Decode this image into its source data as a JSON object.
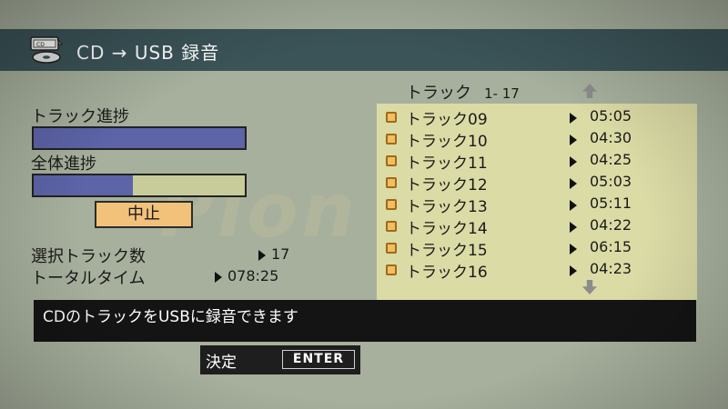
{
  "header": {
    "title": "CD → USB 録音",
    "icon": "cd-icon"
  },
  "progress": {
    "track_label": "トラック進捗",
    "track_fraction": 1.0,
    "total_label": "全体進捗",
    "total_fraction": 0.47,
    "fill_color": "#5d64a8"
  },
  "stop_button": {
    "label": "中止",
    "color": "#f2c27a"
  },
  "info": {
    "selected_label": "選択トラック数",
    "selected_value": "17",
    "total_time_label": "トータルタイム",
    "total_time_value": "078:25"
  },
  "track_list": {
    "header": "トラック",
    "range": "1- 17",
    "items": [
      {
        "name": "トラック09",
        "time": "05:05"
      },
      {
        "name": "トラック10",
        "time": "04:30"
      },
      {
        "name": "トラック11",
        "time": "04:25"
      },
      {
        "name": "トラック12",
        "time": "05:03"
      },
      {
        "name": "トラック13",
        "time": "05:11"
      },
      {
        "name": "トラック14",
        "time": "04:22"
      },
      {
        "name": "トラック15",
        "time": "06:15"
      },
      {
        "name": "トラック16",
        "time": "04:23"
      }
    ]
  },
  "message": "CDのトラックをUSBに録音できます",
  "enter_hint": {
    "label": "決定",
    "key": "ENTER"
  },
  "watermark": "Pion"
}
